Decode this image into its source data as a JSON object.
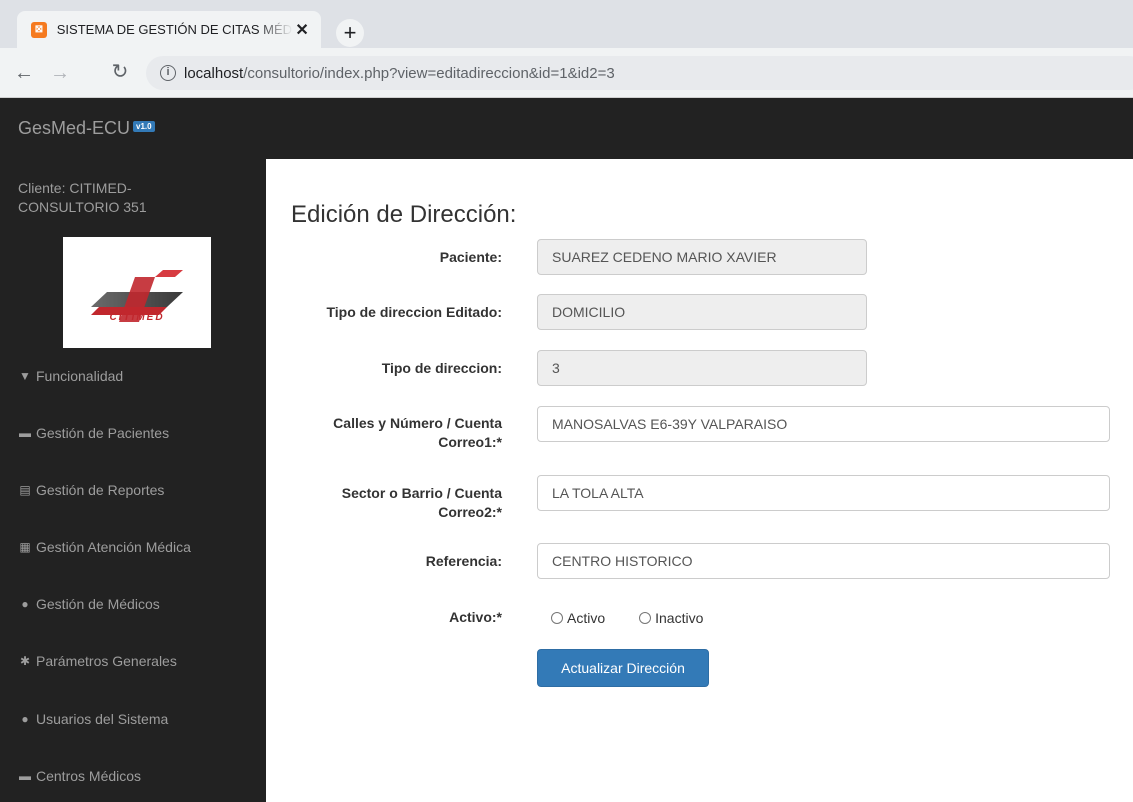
{
  "browser": {
    "tab_title": "SISTEMA DE GESTIÓN DE CITAS MÉDICAS",
    "tab_favicon_glyph": "⊠",
    "url_host": "localhost",
    "url_path": "/consultorio/index.php?view=editadireccion&id=1&id2=3"
  },
  "app": {
    "brand": "GesMed-ECU",
    "version_badge": "v1.0",
    "client_label": "Cliente: CITIMED-CONSULTORIO 351",
    "logo_text": "CITIMED",
    "brand_red": "#c1272d"
  },
  "sidebar": {
    "items": [
      {
        "icon": "filter-icon",
        "glyph": "▼",
        "label": "Funcionalidad"
      },
      {
        "icon": "folder-icon",
        "glyph": "▬",
        "label": "Gestión de Pacientes"
      },
      {
        "icon": "report-icon",
        "glyph": "▤",
        "label": "Gestión de Reportes"
      },
      {
        "icon": "id-card-icon",
        "glyph": "▦",
        "label": "Gestión Atención Médica"
      },
      {
        "icon": "user-icon",
        "glyph": "●",
        "label": "Gestión de Médicos"
      },
      {
        "icon": "gear-icon",
        "glyph": "✱",
        "label": "Parámetros Generales"
      },
      {
        "icon": "users-icon",
        "glyph": "●",
        "label": "Usuarios del Sistema"
      },
      {
        "icon": "briefcase-icon",
        "glyph": "▬",
        "label": "Centros Médicos"
      }
    ]
  },
  "form": {
    "title": "Edición de Dirección:",
    "paciente_label": "Paciente:",
    "paciente_value": "SUAREZ CEDENO MARIO XAVIER",
    "tipo_editado_label": "Tipo de direccion Editado:",
    "tipo_editado_value": "DOMICILIO",
    "tipo_label": "Tipo de direccion:",
    "tipo_value": "3",
    "calles_label_1": "Calles y Número / Cuenta",
    "calles_label_2": "Correo1:*",
    "calles_value": "MANOSALVAS E6-39Y VALPARAISO",
    "sector_label_1": "Sector o Barrio / Cuenta",
    "sector_label_2": "Correo2:*",
    "sector_value": "LA TOLA ALTA",
    "referencia_label": "Referencia:",
    "referencia_value": "CENTRO HISTORICO",
    "activo_label": "Activo:*",
    "radio_activo": "Activo",
    "radio_inactivo": "Inactivo",
    "submit_label": "Actualizar Dirección"
  }
}
